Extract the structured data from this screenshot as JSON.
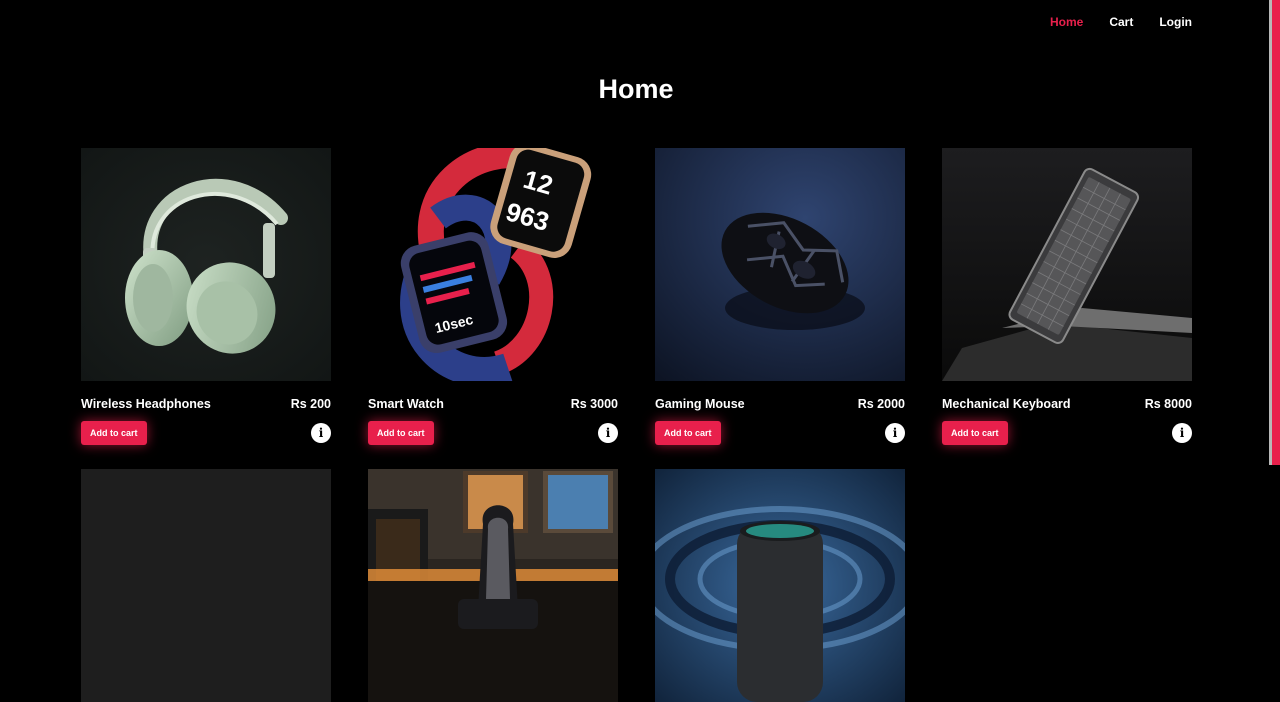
{
  "nav": {
    "home": "Home",
    "cart": "Cart",
    "login": "Login"
  },
  "page": {
    "title": "Home"
  },
  "colors": {
    "accent": "#e8204c",
    "background": "#000000"
  },
  "products": [
    {
      "name": "Wireless Headphones",
      "price": "Rs 200",
      "button": "Add to cart",
      "info_icon": "info-icon"
    },
    {
      "name": "Smart Watch",
      "price": "Rs 3000",
      "button": "Add to cart",
      "info_icon": "info-icon"
    },
    {
      "name": "Gaming Mouse",
      "price": "Rs 2000",
      "button": "Add to cart",
      "info_icon": "info-icon"
    },
    {
      "name": "Mechanical Keyboard",
      "price": "Rs 8000",
      "button": "Add to cart",
      "info_icon": "info-icon"
    }
  ],
  "watch_face": {
    "hour_top": "12",
    "hour_bottom": "963",
    "timer_text": "10sec"
  }
}
